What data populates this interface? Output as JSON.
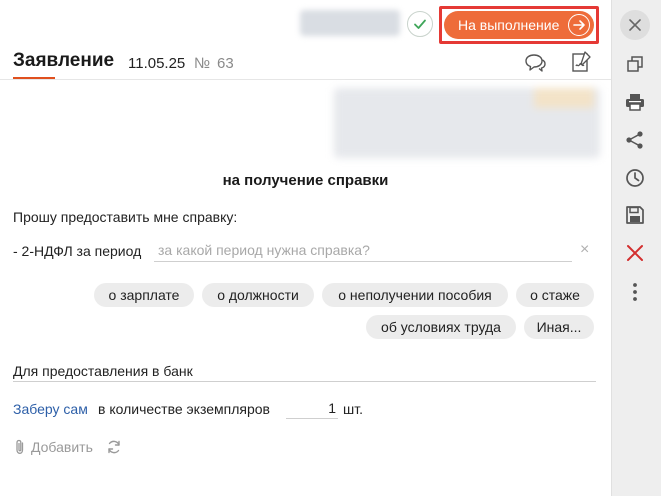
{
  "topbar": {
    "execute_label": "На выполнение"
  },
  "header": {
    "title": "Заявление",
    "date": "11.05.25",
    "number_sign": "№",
    "number": "63"
  },
  "document": {
    "heading": "на получение справки",
    "request_text": "Прошу предоставить мне справку:",
    "ndfl_label": "- 2-НДФЛ за период",
    "period_placeholder": "за какой период нужна справка?",
    "period_value": "",
    "clear_symbol": "×",
    "chips": [
      {
        "label": "о зарплате"
      },
      {
        "label": "о должности"
      },
      {
        "label": "о неполучении пособия"
      },
      {
        "label": "о стаже"
      },
      {
        "label": "об условиях труда"
      },
      {
        "label": "Иная..."
      }
    ],
    "purpose_value": "Для предоставления в банк",
    "pickup_link": "Заберу сам",
    "copies_label": "в количестве экземпляров",
    "copies_value": "1",
    "copies_unit": "шт."
  },
  "attachments": {
    "add_label": "Добавить"
  },
  "sidebar_icons": [
    "close-icon",
    "copy-icon",
    "print-icon",
    "share-icon",
    "history-icon",
    "save-icon",
    "delete-icon",
    "more-icon"
  ],
  "colors": {
    "accent": "#ee6c3a",
    "highlight": "#e53935",
    "link": "#2d5fa8",
    "delete": "#d32f2f"
  }
}
